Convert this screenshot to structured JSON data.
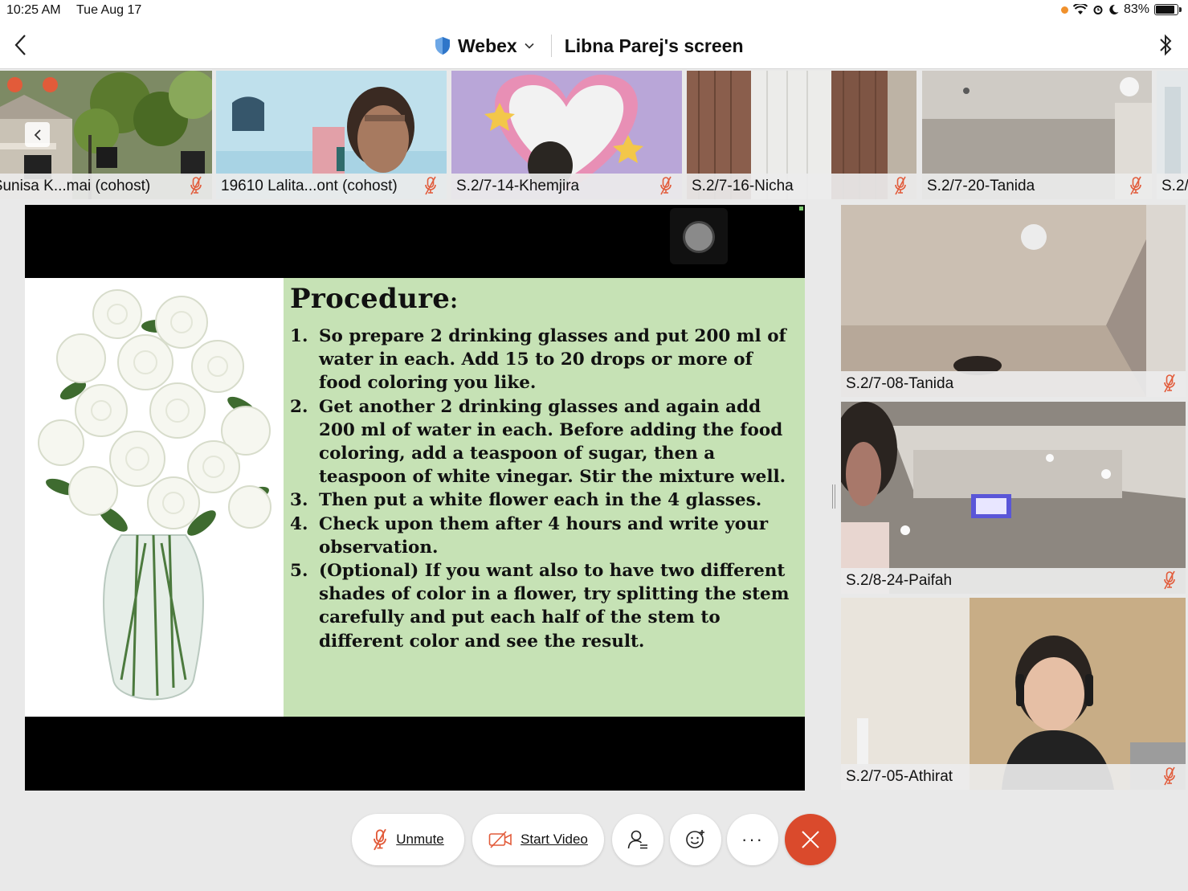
{
  "status_bar": {
    "time": "10:25 AM",
    "date": "Tue Aug 17",
    "battery": "83%",
    "battery_level": 0.83
  },
  "header": {
    "app_name": "Webex",
    "screen_title": "Libna Parej's screen"
  },
  "strip_participants": [
    {
      "name": "s.Sunisa K...mai (cohost)"
    },
    {
      "name": "19610 Lalita...ont (cohost)"
    },
    {
      "name": "S.2/7-14-Khemjira"
    },
    {
      "name": "S.2/7-16-Nicha"
    },
    {
      "name": "S.2/7-20-Tanida"
    },
    {
      "name": "S.2/"
    }
  ],
  "side_participants": [
    {
      "name": "S.2/7-08-Tanida"
    },
    {
      "name": "S.2/8-24-Paifah"
    },
    {
      "name": "S.2/7-05-Athirat"
    }
  ],
  "slide": {
    "heading": "Procedure",
    "heading_colon": ":",
    "steps": [
      {
        "num": "1.",
        "text": "So prepare 2 drinking glasses and put 200 ml of water in each. Add 15 to 20 drops or more of food coloring you like."
      },
      {
        "num": "2.",
        "text": "Get another 2 drinking glasses and again add 200 ml of water in each. Before adding the food coloring, add a teaspoon of sugar, then a teaspoon of white vinegar. Stir the mixture well."
      },
      {
        "num": "3.",
        "text": "Then put a white flower each in the 4 glasses."
      },
      {
        "num": "4.",
        "text": "Check upon them after 4 hours and write your observation."
      },
      {
        "num": "5.",
        "text": "(Optional) If you want also to have two different shades of color in a flower, try splitting the stem carefully and put each half of the stem to different color and see the result."
      }
    ]
  },
  "controls": {
    "unmute": "Unmute",
    "start_video": "Start Video",
    "more": "···"
  },
  "colors": {
    "end_call": "#da4a2c",
    "slide_bg": "#c6e2b5",
    "mic_off": "#e25b3a"
  }
}
